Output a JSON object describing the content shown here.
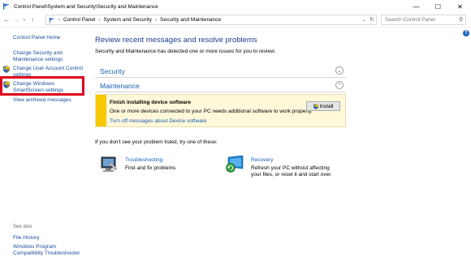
{
  "window": {
    "title": "Control Panel\\System and Security\\Security and Maintenance",
    "controls": [
      "—",
      "☐",
      "✕"
    ]
  },
  "address": {
    "crumbs": [
      "Control Panel",
      "System and Security",
      "Security and Maintenance"
    ],
    "search_placeholder": "Search Control Panel"
  },
  "sidebar": {
    "home": "Control Panel Home",
    "items": [
      {
        "label": "Change Security and Maintenance settings"
      },
      {
        "label": "Change User Account Control settings"
      },
      {
        "label": "Change Windows SmartScreen settings"
      },
      {
        "label": "View archived messages"
      }
    ],
    "see_also": "See also",
    "see_also_items": [
      {
        "label": "File History"
      },
      {
        "label": "Windows Program Compatibility Troubleshooter"
      }
    ]
  },
  "main": {
    "heading": "Review recent messages and resolve problems",
    "subtext": "Security and Maintenance has detected one or more issues for you to review.",
    "sections": [
      {
        "title": "Security"
      },
      {
        "title": "Maintenance"
      }
    ],
    "alert": {
      "title": "Finish installing device software",
      "body": "One or more devices connected to your PC needs additional software to work properly.",
      "link": "Turn off messages about Device software",
      "button": "Install"
    },
    "problem_text": "If you don't see your problem listed, try one of these:",
    "tools": [
      {
        "title": "Troubleshooting",
        "desc": "Find and fix problems"
      },
      {
        "title": "Recovery",
        "desc_line1": "Refresh your PC without affecting",
        "desc_line2": "your files, or reset it and start over."
      }
    ]
  },
  "colors": {
    "link": "#1a5fb4",
    "heading": "#1a3d8f",
    "alert_bar": "#f7c800",
    "highlight": "#e0001b"
  }
}
